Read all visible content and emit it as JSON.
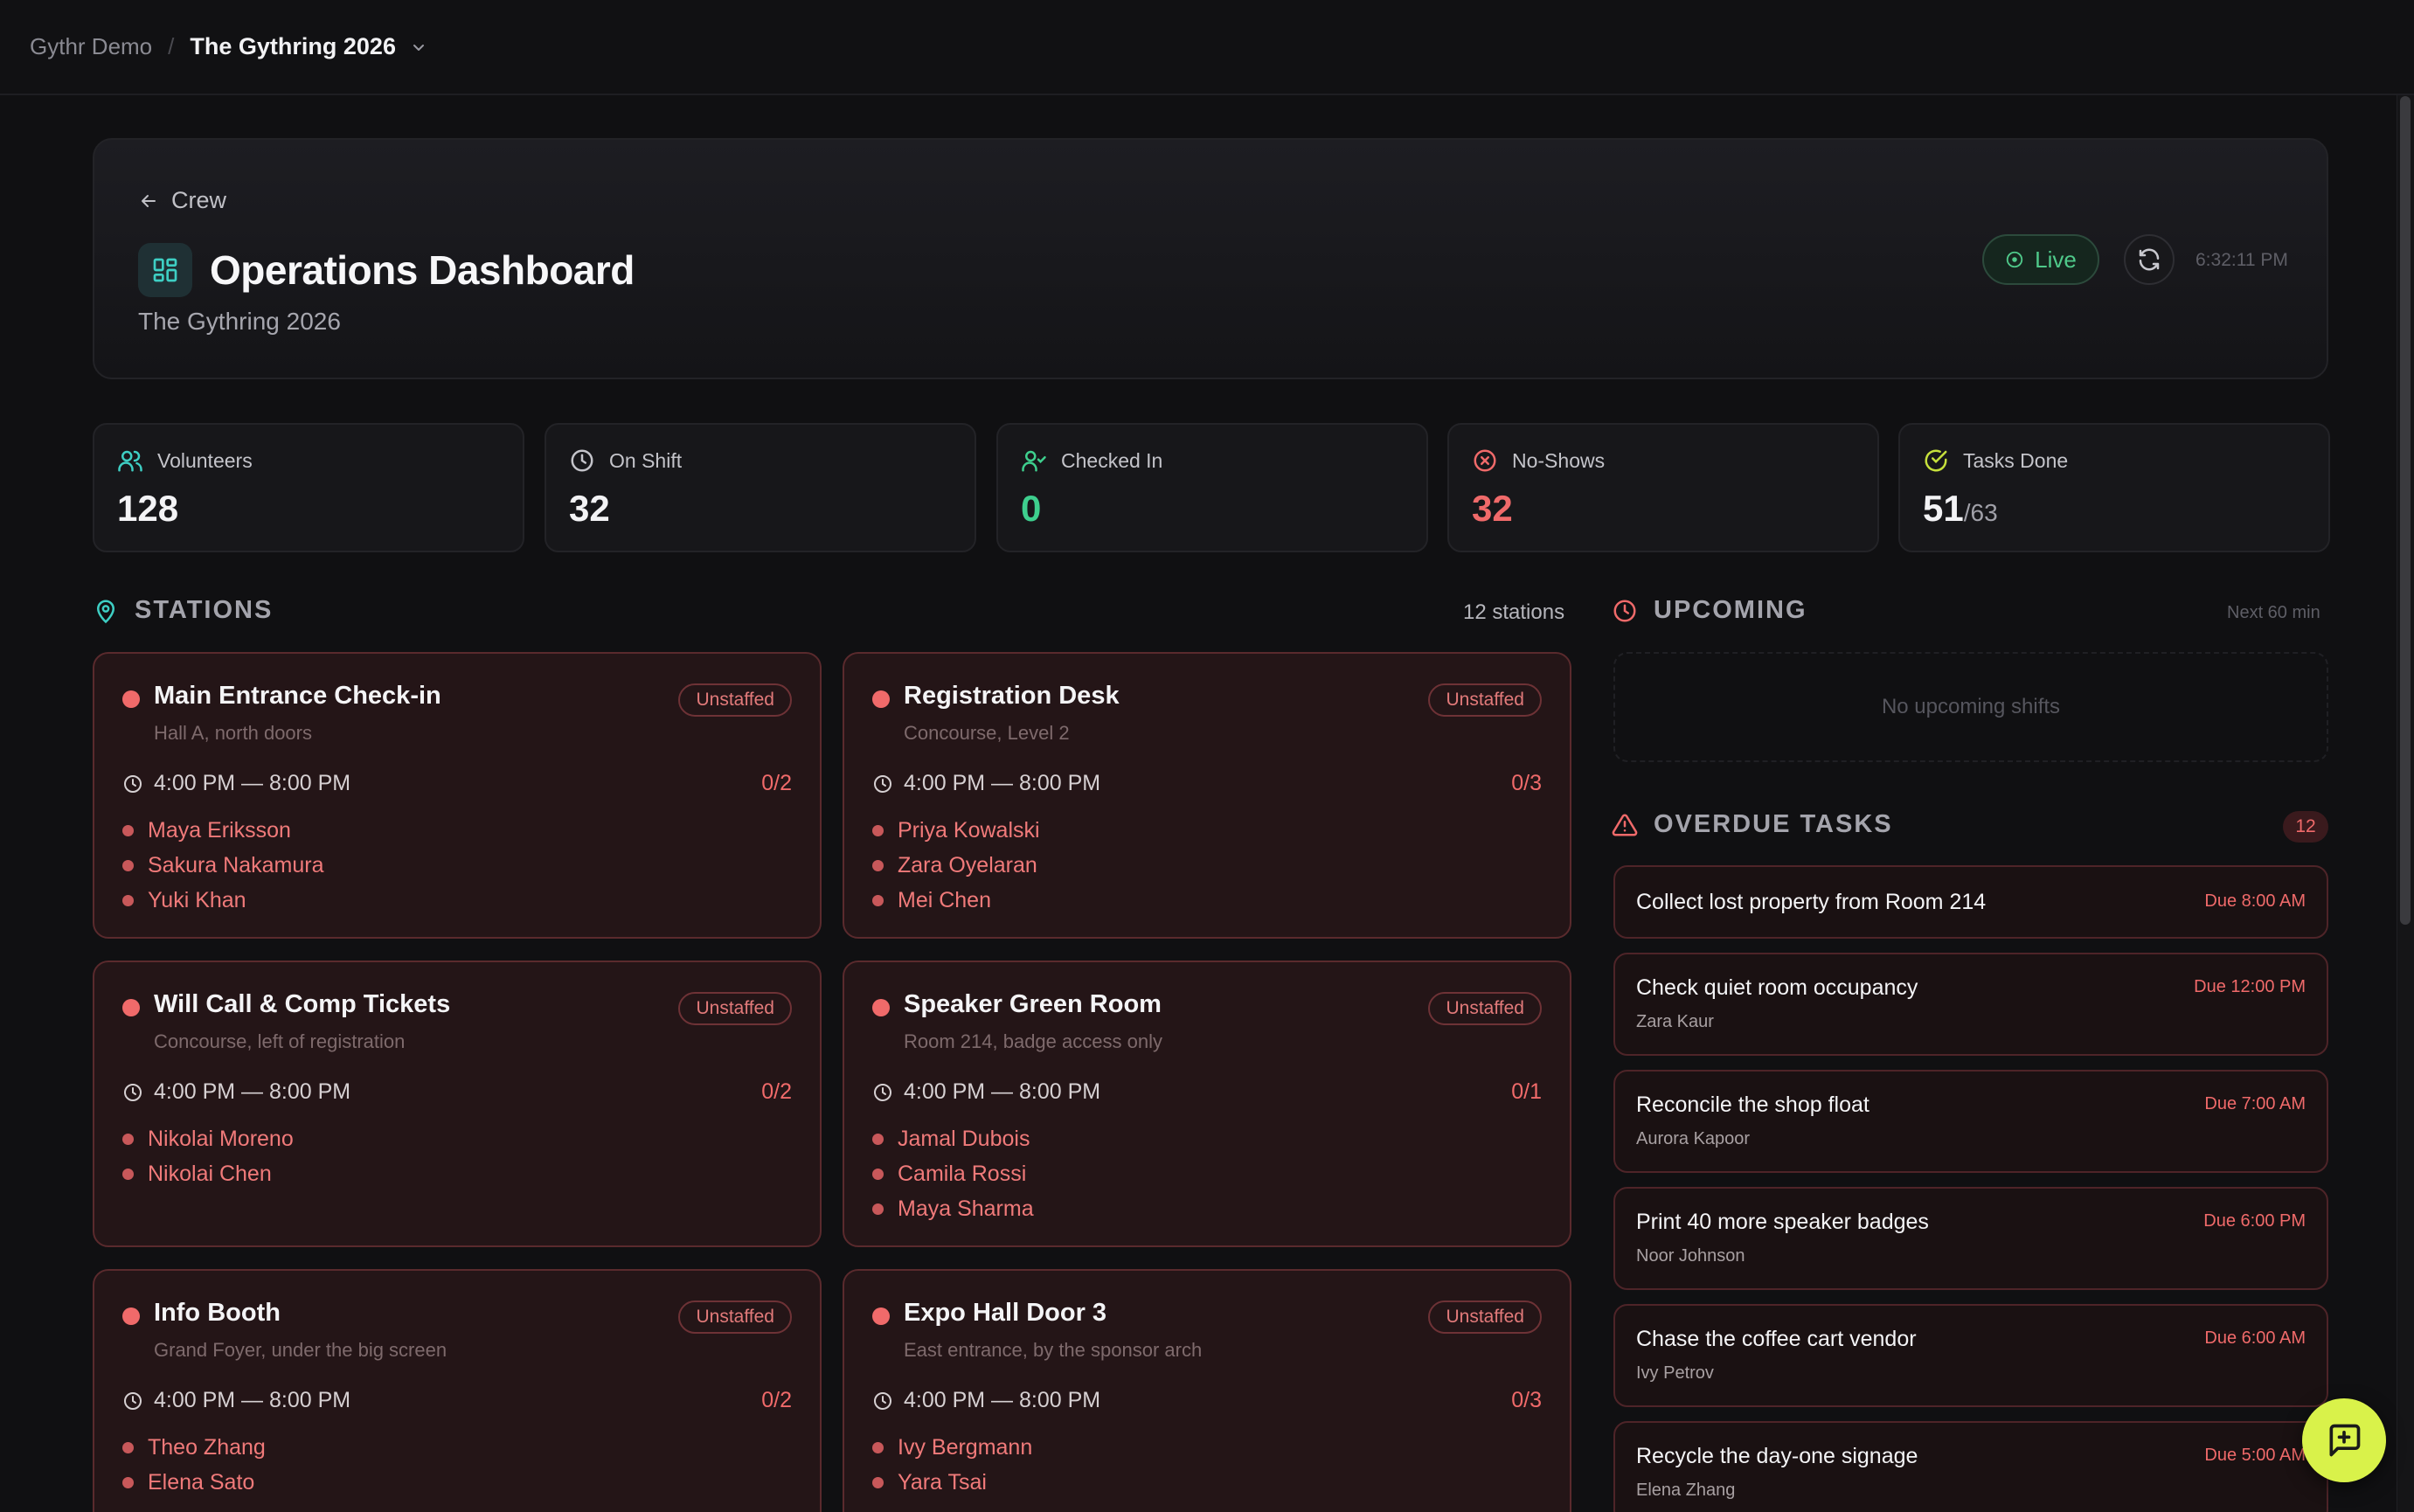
{
  "breadcrumb": {
    "org": "Gythr Demo",
    "separator": "/",
    "event": "The Gythring 2026"
  },
  "header": {
    "back_label": "Crew",
    "title": "Operations Dashboard",
    "subtitle": "The Gythring 2026",
    "live_label": "Live",
    "clock": "6:32:11 PM"
  },
  "stats": {
    "volunteers": {
      "label": "Volunteers",
      "value": "128"
    },
    "on_shift": {
      "label": "On Shift",
      "value": "32"
    },
    "checked_in": {
      "label": "Checked In",
      "value": "0"
    },
    "no_shows": {
      "label": "No-Shows",
      "value": "32"
    },
    "tasks_done": {
      "label": "Tasks Done",
      "value": "51",
      "of": "/63"
    }
  },
  "stations": {
    "heading": "STATIONS",
    "count_label": "12 stations",
    "items": [
      {
        "name": "Main Entrance Check-in",
        "location": "Hall A, north doors",
        "badge": "Unstaffed",
        "time": "4:00 PM — 8:00 PM",
        "count": "0/2",
        "people": [
          "Maya Eriksson",
          "Sakura Nakamura",
          "Yuki Khan"
        ]
      },
      {
        "name": "Registration Desk",
        "location": "Concourse, Level 2",
        "badge": "Unstaffed",
        "time": "4:00 PM — 8:00 PM",
        "count": "0/3",
        "people": [
          "Priya Kowalski",
          "Zara Oyelaran",
          "Mei Chen"
        ]
      },
      {
        "name": "Will Call & Comp Tickets",
        "location": "Concourse, left of registration",
        "badge": "Unstaffed",
        "time": "4:00 PM — 8:00 PM",
        "count": "0/2",
        "people": [
          "Nikolai Moreno",
          "Nikolai Chen"
        ]
      },
      {
        "name": "Speaker Green Room",
        "location": "Room 214, badge access only",
        "badge": "Unstaffed",
        "time": "4:00 PM — 8:00 PM",
        "count": "0/1",
        "people": [
          "Jamal Dubois",
          "Camila Rossi",
          "Maya Sharma"
        ]
      },
      {
        "name": "Info Booth",
        "location": "Grand Foyer, under the big screen",
        "badge": "Unstaffed",
        "time": "4:00 PM — 8:00 PM",
        "count": "0/2",
        "people": [
          "Theo Zhang",
          "Elena Sato"
        ]
      },
      {
        "name": "Expo Hall Door 3",
        "location": "East entrance, by the sponsor arch",
        "badge": "Unstaffed",
        "time": "4:00 PM — 8:00 PM",
        "count": "0/3",
        "people": [
          "Ivy Bergmann",
          "Yara Tsai"
        ]
      }
    ]
  },
  "upcoming": {
    "heading": "UPCOMING",
    "meta": "Next 60 min",
    "empty": "No upcoming shifts"
  },
  "overdue": {
    "heading": "OVERDUE TASKS",
    "count": "12",
    "items": [
      {
        "title": "Collect lost property from Room 214",
        "owner": "",
        "due": "Due 8:00 AM"
      },
      {
        "title": "Check quiet room occupancy",
        "owner": "Zara Kaur",
        "due": "Due 12:00 PM"
      },
      {
        "title": "Reconcile the shop float",
        "owner": "Aurora Kapoor",
        "due": "Due 7:00 AM"
      },
      {
        "title": "Print 40 more speaker badges",
        "owner": "Noor Johnson",
        "due": "Due 6:00 PM"
      },
      {
        "title": "Chase the coffee cart vendor",
        "owner": "Ivy Petrov",
        "due": "Due 6:00 AM"
      },
      {
        "title": "Recycle the day-one signage",
        "owner": "Elena Zhang",
        "due": "Due 5:00 AM"
      }
    ]
  },
  "colors": {
    "accent_teal": "#3ecfc4",
    "success": "#3ecf8e",
    "danger": "#f06a6a",
    "fab": "#d9f24a"
  }
}
